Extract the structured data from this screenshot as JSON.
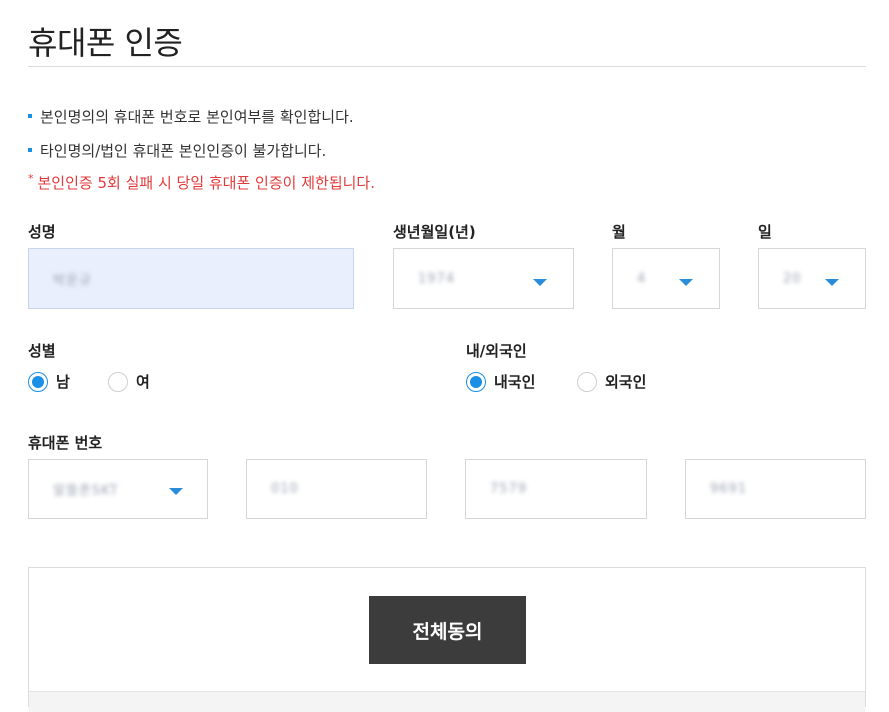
{
  "page": {
    "title": "휴대폰 인증"
  },
  "notices": [
    "본인명의의 휴대폰 번호로 본인여부를 확인합니다.",
    "타인명의/법인 휴대폰 본인인증이 불가합니다."
  ],
  "warning": {
    "star": "*",
    "text": "본인인증 5회 실패 시 당일 휴대폰 인증이 제한됩니다."
  },
  "form": {
    "name": {
      "label": "성명",
      "value": "박운규"
    },
    "birth_year": {
      "label": "생년월일(년)",
      "value": "1974"
    },
    "birth_month": {
      "label": "월",
      "value": "4"
    },
    "birth_day": {
      "label": "일",
      "value": "20"
    },
    "gender": {
      "label": "성별",
      "options": [
        "남",
        "여"
      ],
      "selected": "남"
    },
    "nationality": {
      "label": "내/외국인",
      "options": [
        "내국인",
        "외국인"
      ],
      "selected": "내국인"
    },
    "phone": {
      "label": "휴대폰 번호",
      "carrier": "알뜰폰SKT",
      "part1": "010",
      "part2": "7579",
      "part3": "9691"
    }
  },
  "agree": {
    "button_label": "전체동의"
  },
  "colors": {
    "accent": "#1a8fe6",
    "warning": "#e33b3b",
    "button_bg": "#3c3c3c",
    "filled_bg": "#e9effd"
  }
}
